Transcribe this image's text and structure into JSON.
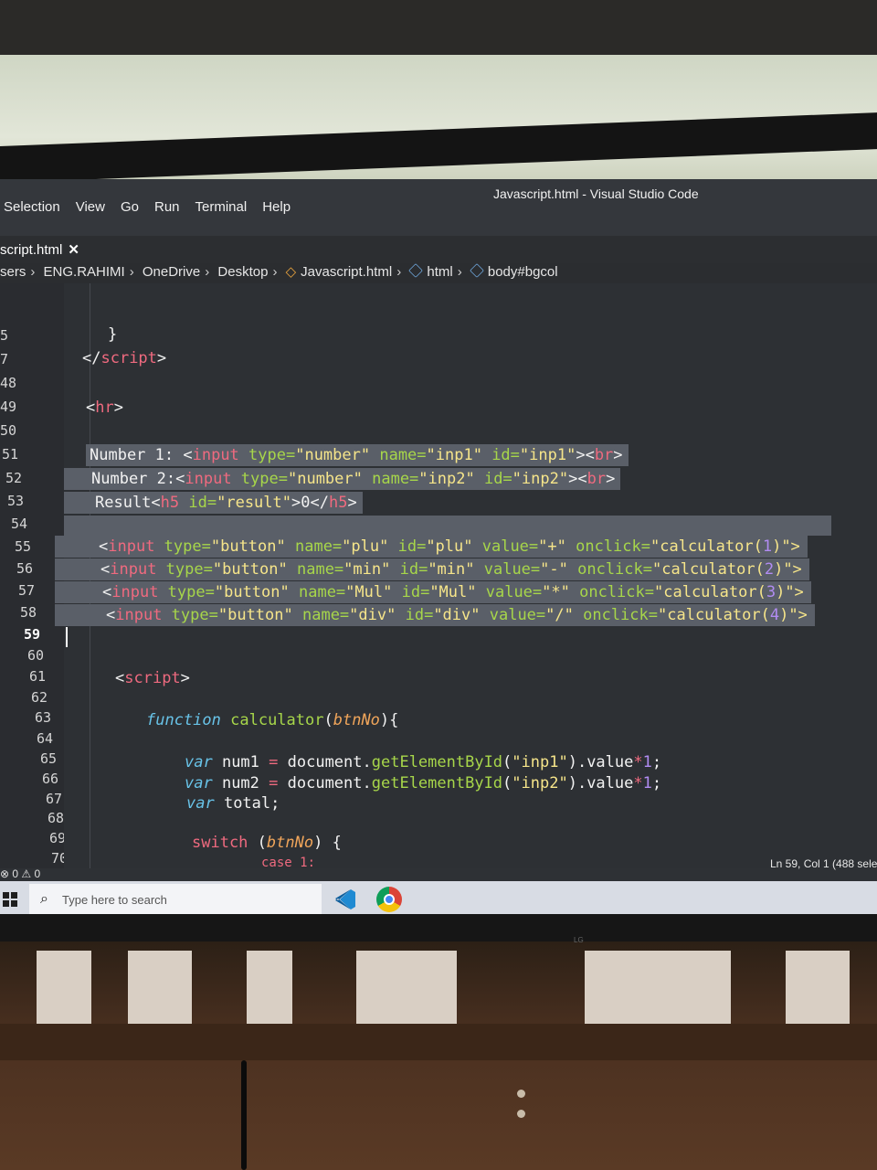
{
  "window": {
    "title": "Javascript.html - Visual Studio Code"
  },
  "menu": [
    "Selection",
    "View",
    "Go",
    "Run",
    "Terminal",
    "Help"
  ],
  "tab": {
    "label": "script.html",
    "close": "✕"
  },
  "breadcrumb": [
    "sers",
    "ENG.RAHIMI",
    "OneDrive",
    "Desktop",
    "Javascript.html",
    "html",
    "body#bgcol"
  ],
  "gutter": [
    "5",
    "7",
    "48",
    "49",
    "50",
    "51",
    "52",
    "53",
    "54",
    "55",
    "56",
    "57",
    "58",
    "59",
    "60",
    "61",
    "62",
    "63",
    "64",
    "65",
    "66",
    "67",
    "68",
    "69",
    "70"
  ],
  "code": {
    "l1": "}",
    "l2a": "</",
    "l2b": "script",
    "l2c": ">",
    "l3a": "<",
    "l3b": "hr",
    "l3c": ">",
    "l4": {
      "a": "Number 1: ",
      "b": "<",
      "c": "input",
      "d": " type=",
      "e": "\"number\"",
      "f": " name=",
      "g": "\"inp1\"",
      "h": " id=",
      "i": "\"inp1\"",
      "j": "><",
      "k": "br",
      "l": ">"
    },
    "l5": {
      "a": "Number 2:",
      "b": "<",
      "c": "input",
      "d": " type=",
      "e": "\"number\"",
      "f": " name=",
      "g": "\"inp2\"",
      "h": " id=",
      "i": "\"inp2\"",
      "j": "><",
      "k": "br",
      "l": ">"
    },
    "l6": {
      "a": "Result",
      "b": "<",
      "c": "h5",
      "d": " id=",
      "e": "\"result\"",
      "f": ">0</",
      "g": "h5",
      "h": ">"
    },
    "buttons": [
      {
        "name": "\"plu\"",
        "id": "\"plu\"",
        "value": "\"+\"",
        "n": "1"
      },
      {
        "name": "\"min\"",
        "id": "\"min\"",
        "value": "\"-\"",
        "n": "2"
      },
      {
        "name": "\"Mul\"",
        "id": "\"Mul\"",
        "value": "\"*\"",
        "n": "3"
      },
      {
        "name": "\"div\"",
        "id": "\"div\"",
        "value": "\"/\"",
        "n": "4"
      }
    ],
    "btn_parts": {
      "lt": "<",
      "tag": "input",
      "type": " type=",
      "typeval": "\"button\"",
      "name": " name=",
      "id": " id=",
      "value": " value=",
      "onclick": " onclick=",
      "fn": "\"calculator(",
      "close": ")\">"
    },
    "script_open": {
      "a": "<",
      "b": "script",
      "c": ">"
    },
    "fn_line": {
      "kw": "function",
      "name": " calculator",
      "p1": "(",
      "param": "btnNo",
      "p2": "){"
    },
    "var1": {
      "kw": "var",
      "a": " num1 ",
      "eq": "=",
      "b": " document.",
      "m": "getElementById",
      "c": "(",
      "s": "\"inp1\"",
      "d": ").value",
      "op": "*",
      "n": "1",
      "e": ";"
    },
    "var2": {
      "kw": "var",
      "a": " num2 ",
      "eq": "=",
      "b": " document.",
      "m": "getElementById",
      "c": "(",
      "s": "\"inp2\"",
      "d": ").value",
      "op": "*",
      "n": "1",
      "e": ";"
    },
    "var3": {
      "kw": "var",
      "a": " total;"
    },
    "switch": {
      "kw": "switch",
      "a": " (",
      "p": "btnNo",
      "b": ") {"
    },
    "case": "case 1:"
  },
  "status": {
    "problems": "⊗ 0 ⚠ 0",
    "position": "Ln 59, Col 1 (488 sele"
  },
  "taskbar": {
    "search_placeholder": "Type here to search"
  },
  "brand": "LG",
  "colors": {
    "editor_bg": "#2d3034",
    "selection": "#5a5f68",
    "tag": "#ef6a7f",
    "attr": "#a7d64a",
    "string": "#f6e58a"
  }
}
